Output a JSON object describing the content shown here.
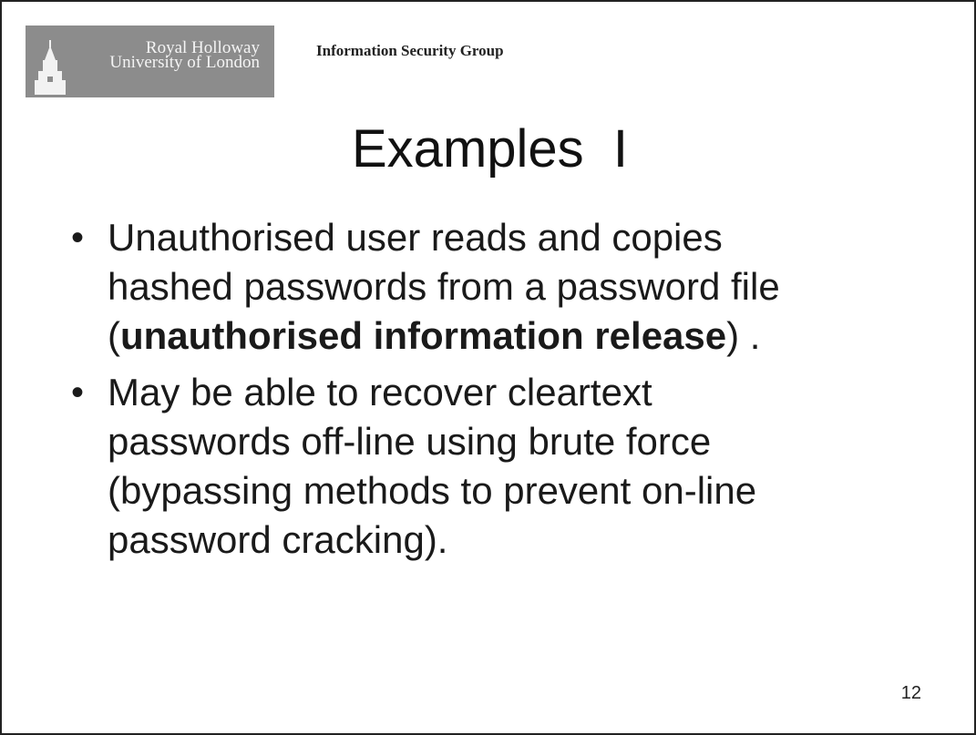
{
  "header": {
    "logo": {
      "line1": "Royal Holloway",
      "line2": "University of London",
      "icon": "tower-icon",
      "background_color": "#8c8c8c"
    },
    "group_name": "Information Security Group"
  },
  "slide": {
    "title": "Examples  I",
    "bullets": [
      {
        "lines": [
          "Unauthorised user reads and copies",
          "hashed passwords from a password file"
        ],
        "last_line_prefix": "(",
        "last_line_bold": "unauthorised information release",
        "last_line_suffix": ") ."
      },
      {
        "lines": [
          "May be able to recover cleartext",
          "passwords off-line using brute force",
          "(bypassing methods to prevent on-line",
          "password cracking)."
        ]
      }
    ],
    "page_number": "12"
  }
}
